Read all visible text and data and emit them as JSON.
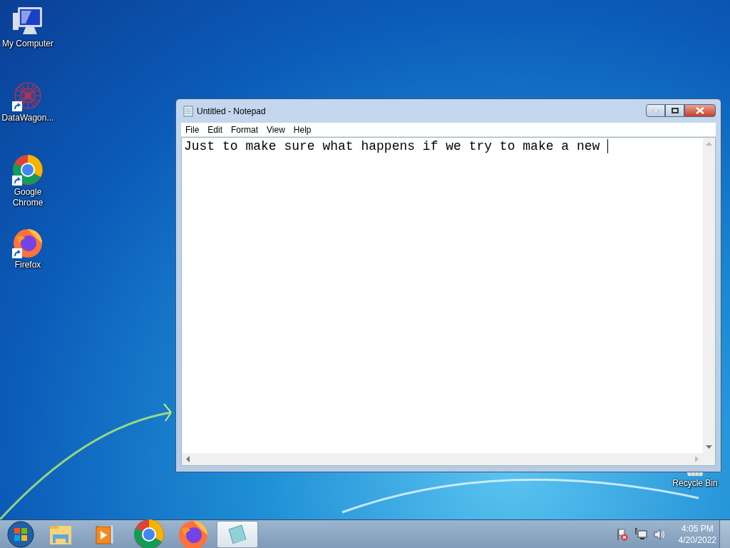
{
  "desktop_icons": [
    {
      "label": "My Computer",
      "kind": "computer",
      "shortcut": false
    },
    {
      "label": "DataWagon...",
      "kind": "network",
      "shortcut": true
    },
    {
      "label": "Google Chrome",
      "kind": "chrome",
      "shortcut": true
    },
    {
      "label": "Firefox",
      "kind": "firefox",
      "shortcut": true
    },
    {
      "label": "Recycle Bin",
      "kind": "bin",
      "shortcut": false
    }
  ],
  "window": {
    "title": "Untitled - Notepad",
    "menu": [
      "File",
      "Edit",
      "Format",
      "View",
      "Help"
    ],
    "text": "Just to make sure what happens if we try to make a new "
  },
  "taskbar": {
    "buttons": [
      {
        "kind": "start",
        "selected": false
      },
      {
        "kind": "folder",
        "selected": false
      },
      {
        "kind": "media",
        "selected": false
      },
      {
        "kind": "chrome",
        "selected": false
      },
      {
        "kind": "firefox",
        "selected": false
      },
      {
        "kind": "notepad",
        "selected": true
      }
    ],
    "time": "4:05 PM",
    "date": "4/20/2022"
  }
}
